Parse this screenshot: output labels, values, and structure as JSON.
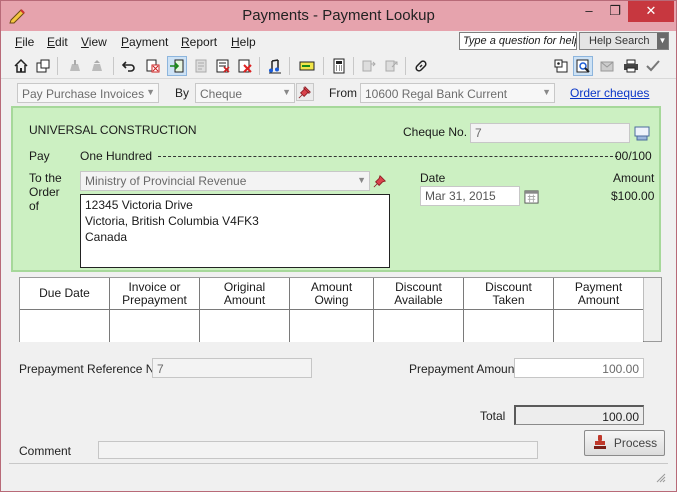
{
  "window": {
    "title": "Payments - Payment Lookup",
    "min": "–",
    "max": "❐",
    "close": "✕"
  },
  "menu": {
    "items": [
      {
        "u": "F",
        "rest": "ile"
      },
      {
        "u": "E",
        "rest": "dit"
      },
      {
        "u": "V",
        "rest": "iew"
      },
      {
        "u": "P",
        "rest": "ayment"
      },
      {
        "u": "R",
        "rest": "eport"
      },
      {
        "u": "H",
        "rest": "elp"
      }
    ],
    "help_question": "Type a question for help",
    "help_search": "Help Search"
  },
  "filter": {
    "type_value": "Pay Purchase Invoices",
    "by_label": "By",
    "by_value": "Cheque",
    "from_label": "From",
    "from_value": "10600 Regal Bank Current",
    "order_cheques": "Order cheques"
  },
  "cheque": {
    "company": "UNIVERSAL CONSTRUCTION",
    "cheque_no_label": "Cheque No.",
    "cheque_no": "7",
    "pay_label": "Pay",
    "amount_words": "One Hundred",
    "cents": "00/100",
    "to_order_label_1": "To the",
    "to_order_label_2": "Order",
    "to_order_label_3": "of",
    "payee": "Ministry of Provincial Revenue",
    "address": [
      "12345 Victoria Drive",
      "Victoria, British Columbia V4FK3",
      "Canada"
    ],
    "date_label": "Date",
    "date": "Mar 31, 2015",
    "amount_label": "Amount",
    "amount": "$100.00"
  },
  "grid": {
    "columns": [
      {
        "l1": "Due Date",
        "l2": ""
      },
      {
        "l1": "Invoice or",
        "l2": "Prepayment"
      },
      {
        "l1": "Original",
        "l2": "Amount"
      },
      {
        "l1": "Amount",
        "l2": "Owing"
      },
      {
        "l1": "Discount",
        "l2": "Available"
      },
      {
        "l1": "Discount",
        "l2": "Taken"
      },
      {
        "l1": "Payment",
        "l2": "Amount"
      }
    ]
  },
  "prepayment": {
    "ref_label": "Prepayment Reference No.",
    "ref_value": "7",
    "amount_label": "Prepayment Amount",
    "amount_value": "100.00"
  },
  "total": {
    "label": "Total",
    "value": "100.00"
  },
  "comment": {
    "label": "Comment",
    "value": ""
  },
  "process": {
    "label": "Process"
  }
}
